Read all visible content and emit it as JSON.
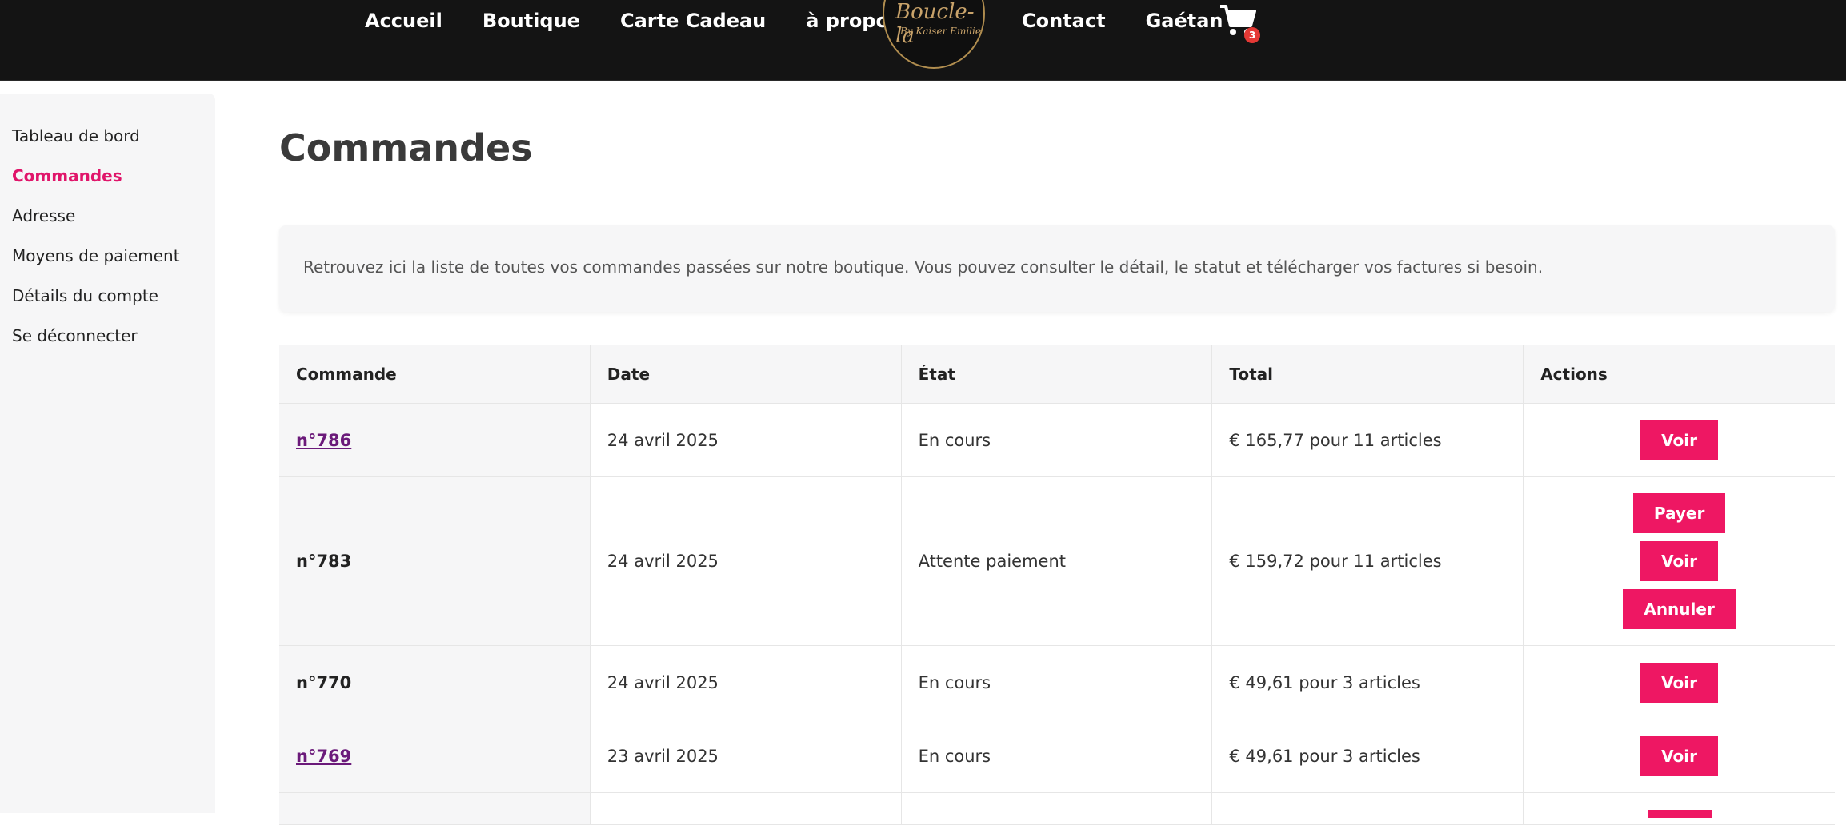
{
  "header": {
    "nav_left": [
      "Accueil",
      "Boutique",
      "Carte Cadeau",
      "à propos"
    ],
    "nav_right": [
      "Contact",
      "Gaétan"
    ],
    "logo_script": "Boucle-la",
    "logo_by": "By Kaiser Emilie",
    "cart_count": "3"
  },
  "sidebar": {
    "items": [
      {
        "label": "Tableau de bord"
      },
      {
        "label": "Commandes",
        "active": true
      },
      {
        "label": "Adresse"
      },
      {
        "label": "Moyens de paiement"
      },
      {
        "label": "Détails du compte"
      },
      {
        "label": "Se déconnecter"
      }
    ]
  },
  "main": {
    "title": "Commandes",
    "info": "Retrouvez ici la liste de toutes vos commandes passées sur notre boutique. Vous pouvez consulter le détail, le statut et télécharger vos factures si besoin.",
    "table": {
      "headers": [
        "Commande",
        "Date",
        "État",
        "Total",
        "Actions"
      ],
      "rows": [
        {
          "order": "n°786",
          "date": "24 avril 2025",
          "state": "En cours",
          "total": "€ 165,77 pour 11 articles",
          "actions": [
            "Voir"
          ]
        },
        {
          "order": "n°783",
          "date": "24 avril 2025",
          "state": "Attente paiement",
          "total": "€ 159,72 pour 11 articles",
          "actions": [
            "Payer",
            "Voir",
            "Annuler"
          ]
        },
        {
          "order": "n°770",
          "date": "24 avril 2025",
          "state": "En cours",
          "total": "€ 49,61 pour 3 articles",
          "actions": [
            "Voir"
          ]
        },
        {
          "order": "n°769",
          "date": "23 avril 2025",
          "state": "En cours",
          "total": "€ 49,61 pour 3 articles",
          "actions": [
            "Voir"
          ]
        }
      ]
    }
  },
  "colors": {
    "accent": "#ee1763",
    "active_link": "#e0156a",
    "order_link": "#6b1a7a",
    "header_bg": "#141414",
    "gold": "#c9a36a"
  },
  "icons": {
    "cart": "shopping-cart-icon"
  }
}
